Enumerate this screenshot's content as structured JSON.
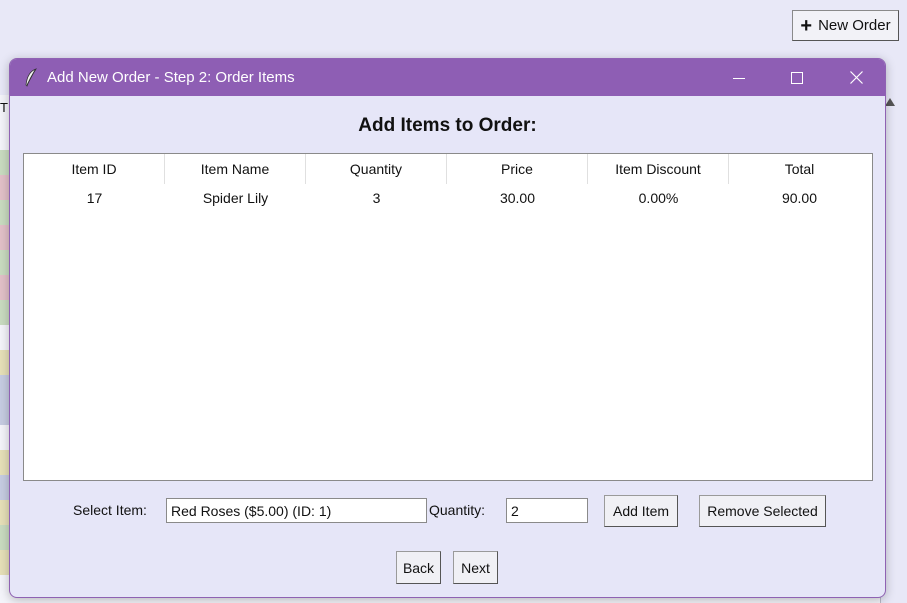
{
  "background": {
    "new_order_label": "New Order",
    "edge_char": "T"
  },
  "dialog": {
    "title": "Add New Order - Step 2: Order Items",
    "heading": "Add Items to Order:",
    "table": {
      "columns": [
        "Item ID",
        "Item Name",
        "Quantity",
        "Price",
        "Item Discount",
        "Total"
      ],
      "rows": [
        [
          "17",
          "Spider Lily",
          "3",
          "30.00",
          "0.00%",
          "90.00"
        ]
      ]
    },
    "select_item_label": "Select Item:",
    "select_item_value": "Red Roses ($5.00) (ID: 1)",
    "quantity_label": "Quantity:",
    "quantity_value": "2",
    "add_item_label": "Add Item",
    "remove_selected_label": "Remove Selected",
    "back_label": "Back",
    "next_label": "Next"
  },
  "colors": {
    "titlebar": "#8e5eb4",
    "dialog_bg": "#e6e6f8"
  },
  "icons": [
    "feather-icon",
    "plus-icon",
    "minimize-icon",
    "maximize-icon",
    "close-icon"
  ]
}
